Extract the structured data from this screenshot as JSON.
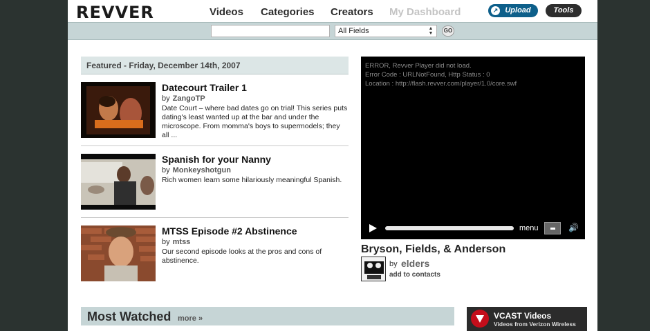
{
  "header": {
    "logo": "REVVER",
    "nav": [
      "Videos",
      "Categories",
      "Creators",
      "My Dashboard"
    ],
    "upload_label": "Upload",
    "tools_label": "Tools"
  },
  "search": {
    "value": "",
    "field_select": "All Fields",
    "go_label": "GO"
  },
  "featured": {
    "heading": "Featured - Friday, December 14th, 2007",
    "items": [
      {
        "title": "Datecourt Trailer 1",
        "by": "by",
        "author": "ZangoTP",
        "description": "Date Court – where bad dates go on trial! This series puts dating's least wanted up at the bar and under the microscope. From momma's boys to supermodels; they all ..."
      },
      {
        "title": "Spanish for your Nanny",
        "by": "by",
        "author": "Monkeyshotgun",
        "description": "Rich women learn some hilariously meaningful Spanish."
      },
      {
        "title": "MTSS Episode #2 Abstinence",
        "by": "by",
        "author": "mtss",
        "description": "Our second episode looks at the pros and cons of abstinence."
      }
    ]
  },
  "player": {
    "error_lines": [
      "ERROR, Revver Player did not load.",
      "Error Code : URLNotFound, Http Status : 0",
      "Location : http://flash.revver.com/player/1.0/core.swf"
    ],
    "menu_label": "menu",
    "video_title": "Bryson, Fields, & Anderson",
    "by": "by",
    "author": "elders",
    "add_contacts": "add to contacts"
  },
  "most_watched": {
    "heading": "Most Watched",
    "more": "more »"
  },
  "vcast": {
    "title": "VCAST Videos",
    "subtitle": "Videos from Verizon Wireless"
  }
}
